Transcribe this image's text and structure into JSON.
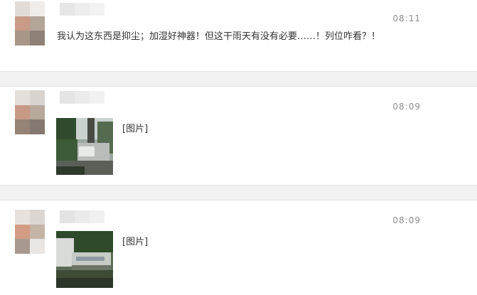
{
  "messages": [
    {
      "time": "08:11",
      "text": "我认为这东西是抑尘；加湿好神器！但这干雨天有没有必要……！列位咋看？！"
    },
    {
      "time": "08:09",
      "image_label": "[图片]"
    },
    {
      "time": "08:09",
      "image_label": "[图片]"
    }
  ],
  "avatar_colors": [
    "#c9b8aa",
    "#b9a797",
    "#d09a84",
    "#a29388",
    "#e8e2de",
    "#d6d2cf"
  ]
}
